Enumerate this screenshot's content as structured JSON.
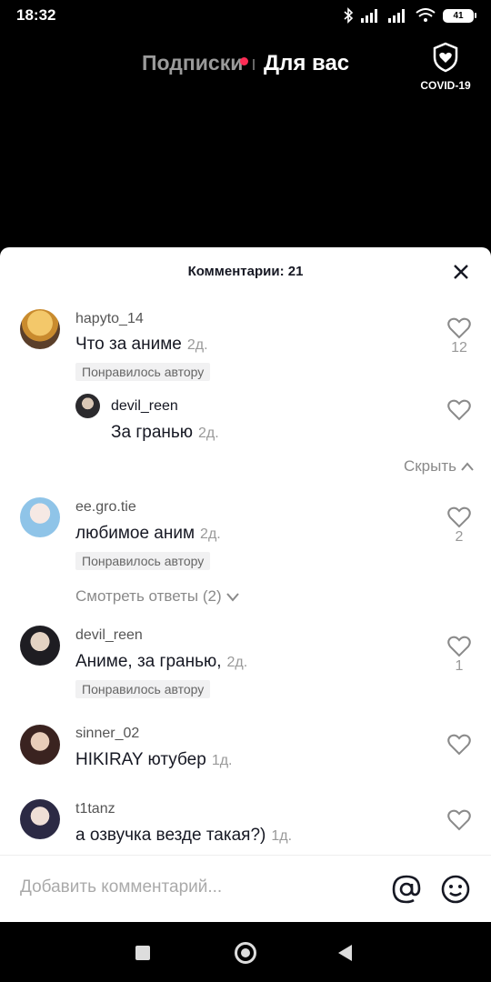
{
  "status_bar": {
    "time": "18:32",
    "battery": "41"
  },
  "top_nav": {
    "following_tab": "Подписки",
    "for_you_tab": "Для вас",
    "covid_label": "COVID-19"
  },
  "comments_sheet": {
    "title": "Комментарии: 21",
    "comments": [
      {
        "username": "hapyto_14",
        "text": "Что за аниме",
        "time": "2д.",
        "badge": "Понравилось автору",
        "likes": "12"
      },
      {
        "username": "devil_reen",
        "text": "За гранью",
        "time": "2д."
      },
      {
        "username": "ee.gro.tie",
        "text": "любимое аним",
        "time": "2д.",
        "badge": "Понравилось автору",
        "likes": "2"
      },
      {
        "username": "devil_reen",
        "text": "Аниме, за гранью,",
        "time": "2д.",
        "badge": "Понравилось автору",
        "likes": "1"
      },
      {
        "username": "sinner_02",
        "text": "HIKIRAY ютубер",
        "time": "1д."
      },
      {
        "username": "t1tanz",
        "text": "а озвучка везде такая?)",
        "time": "1д."
      }
    ],
    "collapse_label": "Скрыть",
    "view_replies_label": "Смотреть ответы (2)"
  },
  "input_bar": {
    "placeholder": "Добавить комментарий..."
  },
  "colors": {
    "accent": "#fe2c55",
    "text": "#161823",
    "muted": "#8a8a8a"
  }
}
